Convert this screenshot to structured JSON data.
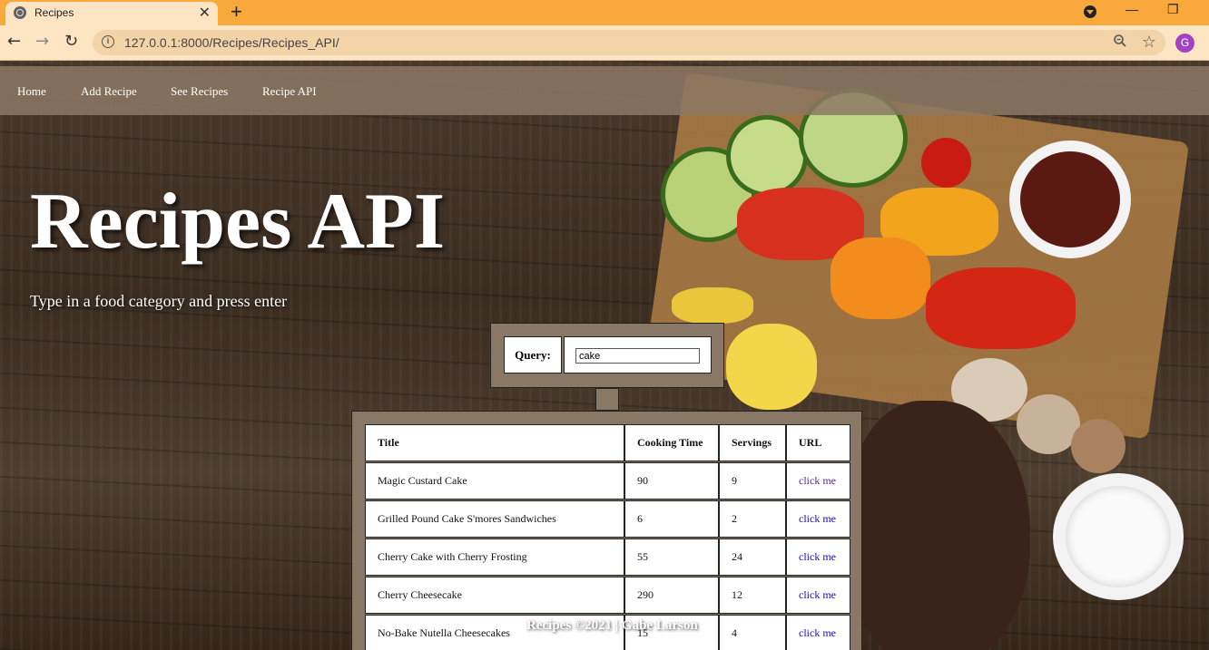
{
  "browser": {
    "tab_title": "Recipes",
    "url": "127.0.0.1:8000/Recipes/Recipes_API/",
    "profile_initial": "G"
  },
  "nav": {
    "items": [
      {
        "label": "Home"
      },
      {
        "label": "Add Recipe"
      },
      {
        "label": "See Recipes"
      },
      {
        "label": "Recipe API"
      }
    ]
  },
  "hero": {
    "title": "Recipes API",
    "subtitle": "Type in a food category and press enter"
  },
  "query": {
    "label": "Query:",
    "value": "cake"
  },
  "results": {
    "headers": [
      "Title",
      "Cooking Time",
      "Servings",
      "URL"
    ],
    "rows": [
      {
        "title": "Magic Custard Cake",
        "time": "90",
        "servings": "9",
        "url": "click me"
      },
      {
        "title": "Grilled Pound Cake S'mores Sandwiches",
        "time": "6",
        "servings": "2",
        "url": "click me"
      },
      {
        "title": "Cherry Cake with Cherry Frosting",
        "time": "55",
        "servings": "24",
        "url": "click me"
      },
      {
        "title": "Cherry Cheesecake",
        "time": "290",
        "servings": "12",
        "url": "click me"
      },
      {
        "title": "No-Bake Nutella Cheesecakes",
        "time": "15",
        "servings": "4",
        "url": "click me"
      }
    ]
  },
  "footer": {
    "text": "Recipes ©2021 | Gabe Larson"
  }
}
